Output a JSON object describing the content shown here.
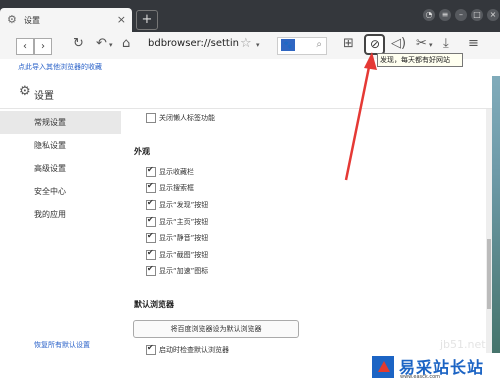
{
  "tab": {
    "title": "设置"
  },
  "toolbar": {
    "back": "‹",
    "forward": "›",
    "address": "bdbrowser://settin",
    "search_engine": "🐾"
  },
  "tooltip": "发现，每天都有好网站",
  "bookmark_bar": {
    "import_text": "点此导入其他浏览器的收藏"
  },
  "settings": {
    "title": "设置",
    "sidebar": [
      {
        "label": "常规设置",
        "active": true
      },
      {
        "label": "隐私设置",
        "active": false
      },
      {
        "label": "高级设置",
        "active": false
      },
      {
        "label": "安全中心",
        "active": false
      },
      {
        "label": "我的应用",
        "active": false
      }
    ],
    "restore_defaults": "恢复所有默认设置",
    "top_option": "关闭懒人标签功能",
    "appearance": {
      "heading": "外观",
      "options": [
        "显示收藏栏",
        "显示搜索框",
        "显示“发现”按钮",
        "显示“主页”按钮",
        "显示“静音”按钮",
        "显示“截图”按钮",
        "显示“加速”图标"
      ]
    },
    "default_browser": {
      "heading": "默认浏览器",
      "button": "将百度浏览器设为默认浏览器",
      "check_on_start": "启动时检查默认浏览器"
    }
  },
  "watermark": {
    "url": "jb51.net",
    "name": "易采站长站",
    "sub": "www.easck.com"
  }
}
